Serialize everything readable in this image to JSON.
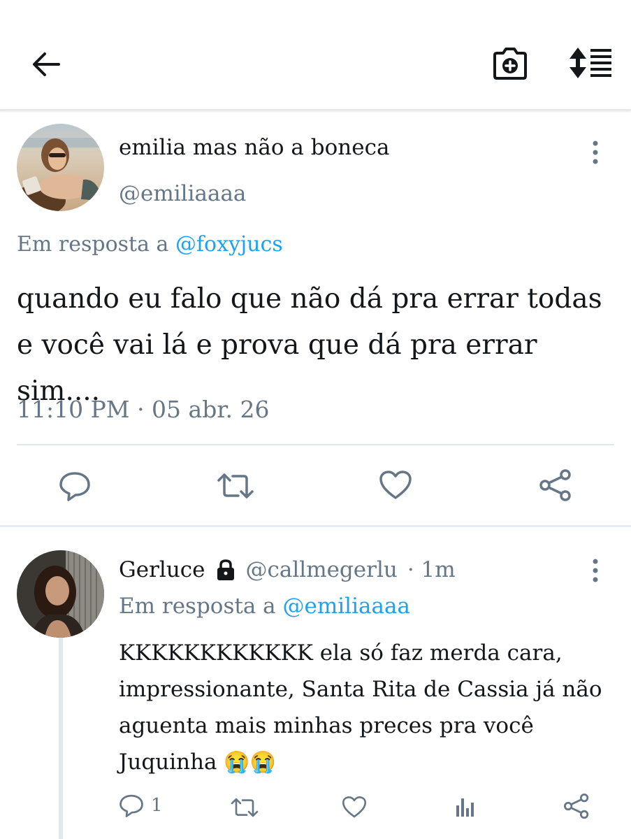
{
  "header": {
    "back_icon": "arrow-left-icon",
    "camera_icon": "camera-add-icon",
    "sort_icon": "sort-list-icon"
  },
  "tweet": {
    "display_name": "emilia mas não a boneca",
    "handle": "@emiliaaaa",
    "reply_prefix": "Em resposta a",
    "reply_to": "@foxyjucs",
    "text": "quando eu falo que não dá pra errar todas e você vai lá e prova que dá pra errar sim....",
    "timestamp": "11:10 PM · 05 abr. 26",
    "actions": [
      "reply-icon",
      "retweet-icon",
      "like-icon",
      "share-icon"
    ]
  },
  "reply": {
    "display_name": "Gerluce",
    "handle": "@callmegerlu",
    "time": "· 1m",
    "reply_prefix": "Em resposta a",
    "reply_to": "@emiliaaaa",
    "line1": "KKKKKKKKKKKK ela só faz merda cara,",
    "line2": "impressionante, Santa Rita de Cassia já não",
    "line3": "aguenta mais minhas preces pra você",
    "line4": "Juquinha",
    "emoji": "😭😭",
    "reply_count": "1",
    "actions": [
      "reply-icon",
      "retweet-icon",
      "like-icon",
      "analytics-icon",
      "share-icon"
    ]
  },
  "colors": {
    "link": "#1da1f2",
    "secondary": "#657786",
    "text": "#14171a"
  }
}
